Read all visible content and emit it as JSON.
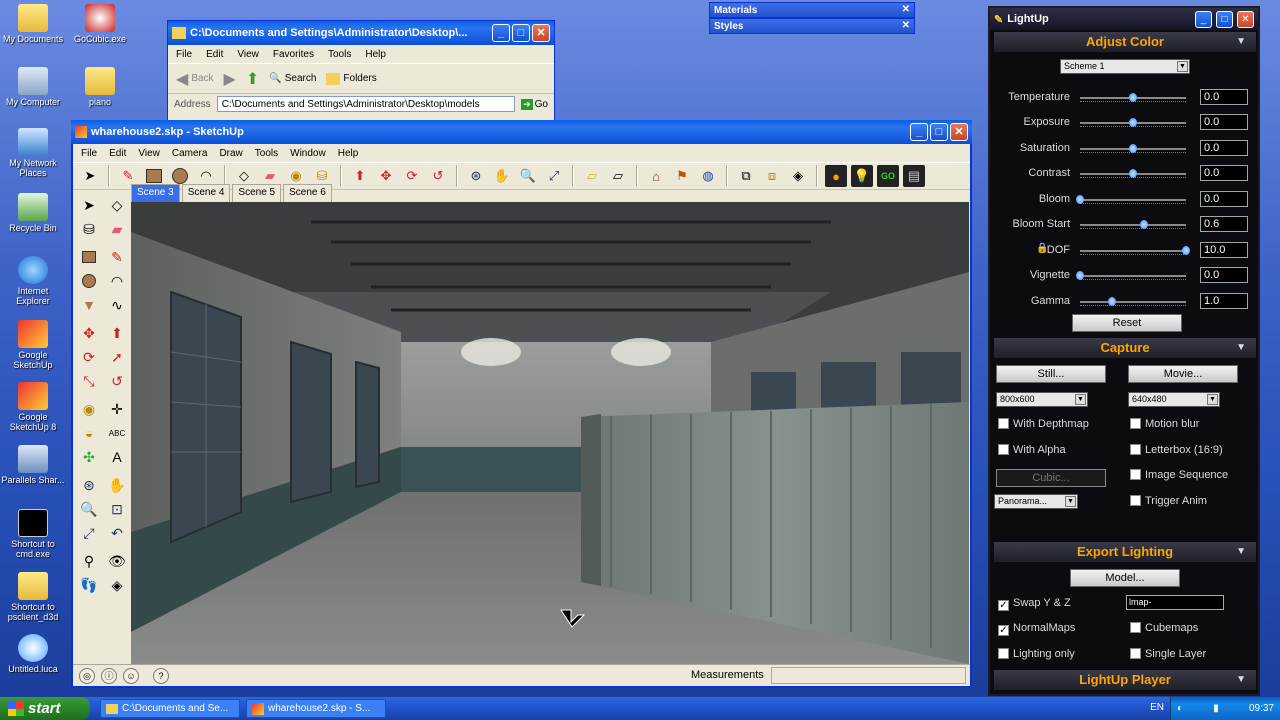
{
  "desktop": {
    "icons": [
      {
        "label": "My Documents"
      },
      {
        "label": "GoCubic.exe"
      },
      {
        "label": "My Computer"
      },
      {
        "label": "piano"
      },
      {
        "label": "My Network Places"
      },
      {
        "label": "Recycle Bin"
      },
      {
        "label": "Internet Explorer"
      },
      {
        "label": "Google SketchUp"
      },
      {
        "label": "Google SketchUp 8"
      },
      {
        "label": "Parallels Shar..."
      },
      {
        "label": "Shortcut to cmd.exe"
      },
      {
        "label": "Shortcut to psclient_d3d"
      },
      {
        "label": "Untitled.luca"
      }
    ]
  },
  "explorer": {
    "title": "C:\\Documents and Settings\\Administrator\\Desktop\\...",
    "menu": [
      "File",
      "Edit",
      "View",
      "Favorites",
      "Tools",
      "Help"
    ],
    "back": "Back",
    "search": "Search",
    "folders": "Folders",
    "address_label": "Address",
    "address": "C:\\Documents and Settings\\Administrator\\Desktop\\models",
    "go": "Go"
  },
  "panels": {
    "materials": "Materials",
    "styles": "Styles"
  },
  "sketchup": {
    "title": "wharehouse2.skp - SketchUp",
    "menu": [
      "File",
      "Edit",
      "View",
      "Camera",
      "Draw",
      "Tools",
      "Window",
      "Help"
    ],
    "scenes": [
      "Scene 3",
      "Scene 4",
      "Scene 5",
      "Scene 6"
    ],
    "active_scene": "Scene 3",
    "measurements_label": "Measurements"
  },
  "lightup": {
    "title": "LightUp",
    "adjust_color": "Adjust Color",
    "scheme": "Scheme 1",
    "sliders": [
      {
        "label": "Temperature",
        "value": "0.0",
        "pos": 0.5
      },
      {
        "label": "Exposure",
        "value": "0.0",
        "pos": 0.5
      },
      {
        "label": "Saturation",
        "value": "0.0",
        "pos": 0.5
      },
      {
        "label": "Contrast",
        "value": "0.0",
        "pos": 0.5
      },
      {
        "label": "Bloom",
        "value": "0.0",
        "pos": 0.0
      },
      {
        "label": "Bloom Start",
        "value": "0.6",
        "pos": 0.6
      },
      {
        "label": "DOF",
        "value": "10.0",
        "pos": 1.0
      },
      {
        "label": "Vignette",
        "value": "0.0",
        "pos": 0.0
      },
      {
        "label": "Gamma",
        "value": "1.0",
        "pos": 0.3
      }
    ],
    "reset": "Reset",
    "capture": "Capture",
    "still": "Still...",
    "movie": "Movie...",
    "still_size": "800x600",
    "movie_size": "640x480",
    "with_depthmap": "With Depthmap",
    "motion_blur": "Motion blur",
    "with_alpha": "With Alpha",
    "letterbox": "Letterbox (16:9)",
    "cubic": "Cubic...",
    "image_sequence": "Image Sequence",
    "panorama": "Panorama...",
    "trigger_anim": "Trigger Anim",
    "export_lighting": "Export Lighting",
    "model": "Model...",
    "swap_yz": "Swap Y & Z",
    "lmap_value": "lmap-",
    "normal_maps": "NormalMaps",
    "cubemaps": "Cubemaps",
    "lighting_only": "Lighting only",
    "single_layer": "Single Layer",
    "player": "LightUp Player"
  },
  "taskbar": {
    "start": "start",
    "tasks": [
      "C:\\Documents and Se...",
      "wharehouse2.skp - S..."
    ],
    "lang": "EN",
    "time": "09:37"
  }
}
